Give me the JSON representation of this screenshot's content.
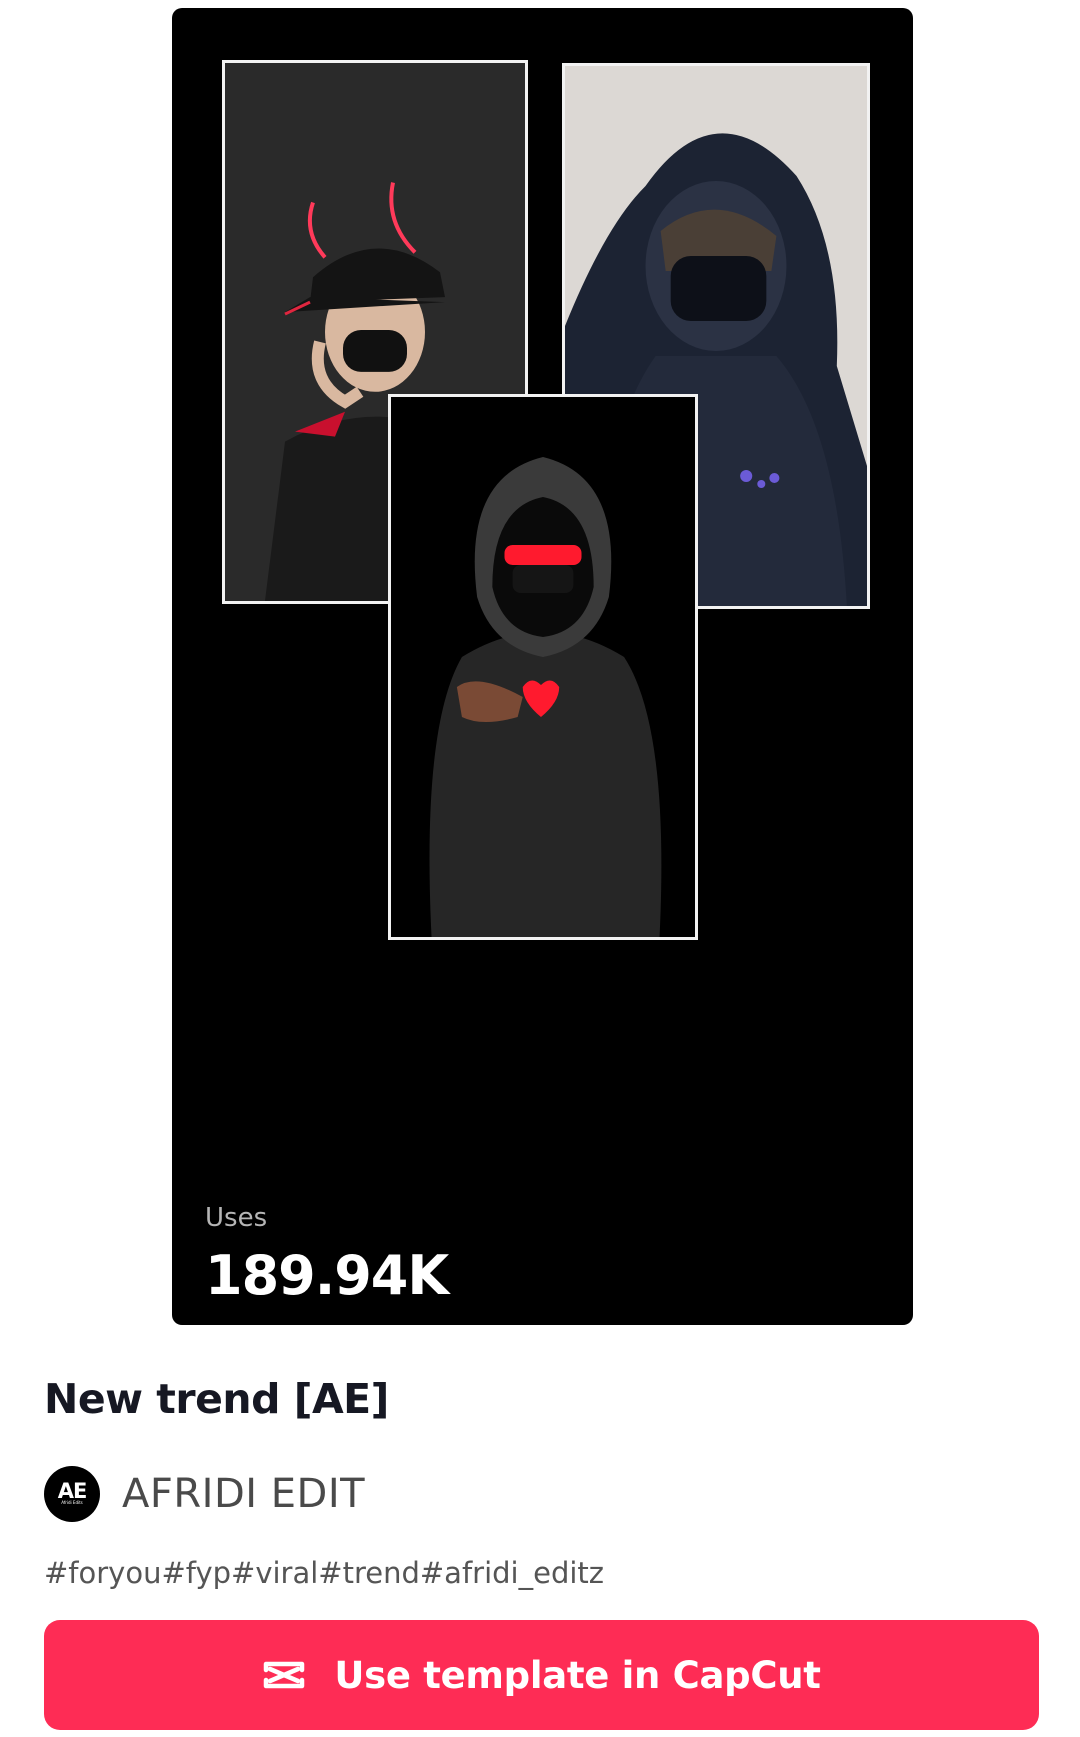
{
  "preview": {
    "uses_label": "Uses",
    "uses_count": "189.94K"
  },
  "template": {
    "title": "New trend [AE]"
  },
  "author": {
    "avatar_monogram": "AE",
    "avatar_subtext": "Afridi Edits",
    "name": "AFRIDI EDIT"
  },
  "hashtags": "#foryou#fyp#viral#trend#afridi_editz",
  "cta": {
    "label": "Use template in CapCut",
    "icon": "capcut-icon"
  },
  "colors": {
    "accent": "#fe2c55",
    "preview_bg": "#000000"
  }
}
